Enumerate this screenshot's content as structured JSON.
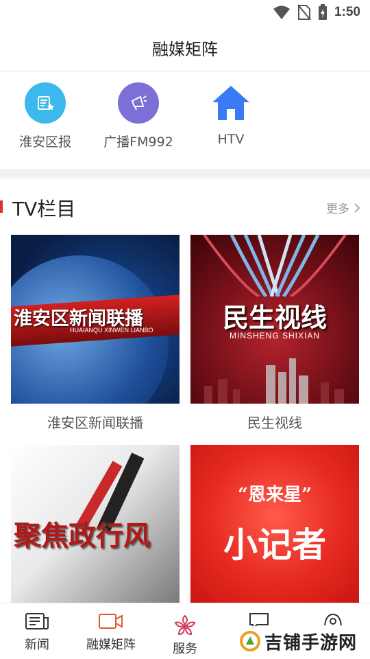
{
  "status_bar": {
    "time": "1:50",
    "icons": [
      "wifi-icon",
      "no-sim-icon",
      "battery-charging-icon"
    ]
  },
  "header": {
    "title": "融媒矩阵"
  },
  "platforms": [
    {
      "label": "淮安区报",
      "icon": "newspaper-icon",
      "color": "#3db8ec"
    },
    {
      "label": "广播FM992",
      "icon": "megaphone-icon",
      "color": "#7c6fd6"
    },
    {
      "label": "HTV",
      "icon": "home-icon",
      "color": "#3a7bf5"
    }
  ],
  "section": {
    "title": "TV栏目",
    "more": "更多",
    "accent": "#e03030"
  },
  "cards": [
    {
      "caption": "淮安区新闻联播",
      "thumb_title": "淮安区新闻联播",
      "thumb_sub": "HUAIANQU XINWEN LIANBO"
    },
    {
      "caption": "民生视线",
      "thumb_title": "民生视线",
      "thumb_sub": "MINSHENG SHIXIAN"
    },
    {
      "caption": "",
      "thumb_title": "聚焦政行风",
      "thumb_sub": ""
    },
    {
      "caption": "",
      "thumb_title": "小记者",
      "thumb_sub": "“恩来星”"
    }
  ],
  "bottom_nav": {
    "items": [
      {
        "label": "新闻",
        "icon": "news-icon"
      },
      {
        "label": "融媒矩阵",
        "icon": "video-camera-icon",
        "active": true
      },
      {
        "label": "服务",
        "icon": "flower-icon"
      },
      {
        "label": "",
        "icon": "chat-icon"
      },
      {
        "label": "",
        "icon": "profile-icon"
      }
    ],
    "active_color": "#e2582e"
  },
  "watermark": {
    "text": "吉铺手游网"
  }
}
